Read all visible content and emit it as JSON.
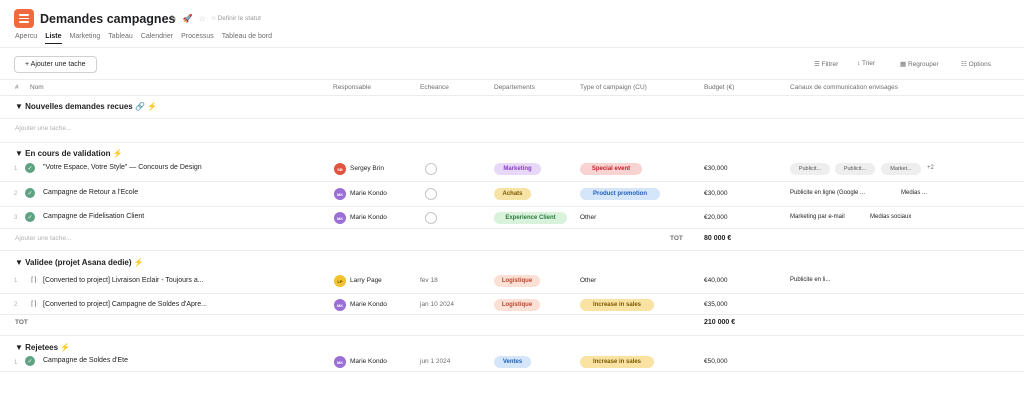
{
  "header": {
    "title": "Demandes campagnes",
    "status": "○ Definir le statut",
    "tabs": [
      "Apercu",
      "Liste",
      "Marketing",
      "Tableau",
      "Calendrier",
      "Processus",
      "Tableau de bord"
    ]
  },
  "toolbar": {
    "add_task": "+ Ajouter une tache",
    "filter": "☰ Filtrer",
    "sort": "↕ Trier",
    "group": "▦ Regrouper",
    "options": "☷ Options"
  },
  "columns": {
    "hash": "#",
    "name": "Nom",
    "owner": "Responsable",
    "due": "Echeance",
    "dept": "Departements",
    "type": "Type of campaign (CU)",
    "budget": "Budget (€)",
    "channels": "Canaux de communication envisages"
  },
  "sections": {
    "s1": {
      "title": "▼ Nouvelles demandes recues 🔗 ⚡",
      "add": "Ajouter une tache..."
    },
    "s2": {
      "title": "▼ En cours de validation ⚡",
      "add": "Ajouter une tache...",
      "tot_label": "TOT",
      "tot_value": "80 000 €",
      "rows": [
        {
          "num": "1",
          "name": "\"Votre Espace, Votre Style\" — Concours de Design",
          "avatar": "SB",
          "owner": "Sergey Brin",
          "dept": "Marketing",
          "type": "Special event",
          "budget": "€30,000",
          "chips": [
            "Publicit...",
            "Publicit...",
            "Market..."
          ],
          "more": "+2"
        },
        {
          "num": "2",
          "name": "Campagne de Retour a l'Ecole",
          "avatar": "MK",
          "owner": "Marie Kondo",
          "dept": "Achats",
          "type": "Product promotion",
          "budget": "€30,000",
          "chan1": "Publicite en ligne (Google ...",
          "chan2": "Medias ..."
        },
        {
          "num": "3",
          "name": "Campagne de Fidelisation Client",
          "avatar": "MK",
          "owner": "Marie Kondo",
          "dept": "Experience Client",
          "type": "Other",
          "budget": "€20,000",
          "chan1": "Marketing par e-mail",
          "chan2": "Medias sociaux"
        }
      ]
    },
    "s3": {
      "title": "▼ Validee (projet Asana dedie) ⚡",
      "tot_label": "TOT",
      "tot_value": "210 000 €",
      "rows": [
        {
          "num": "1",
          "name": "[Converted to project] Livraison Eclair - Toujours a...",
          "avatar": "LP",
          "owner": "Larry Page",
          "due": "fev 18",
          "dept": "Logistique",
          "type": "Other",
          "budget": "€40,000",
          "chan1": "Publicite en li..."
        },
        {
          "num": "2",
          "name": "[Converted to project] Campagne de Soldes d'Apre...",
          "avatar": "MK",
          "owner": "Marie Kondo",
          "due": "jan 10 2024",
          "dept": "Logistique",
          "type": "Increase in sales",
          "budget": "€35,000"
        }
      ]
    },
    "s4": {
      "title": "▼ Rejetees ⚡",
      "rows": [
        {
          "num": "1",
          "name": "Campagne de Soldes d'Ete",
          "avatar": "MK",
          "owner": "Marie Kondo",
          "due": "jun 1 2024",
          "dept": "Ventes",
          "type": "Increase in sales",
          "budget": "€50,000"
        }
      ]
    }
  },
  "colors": {
    "accent": "#f06a3d",
    "check": "#5da283",
    "marketing_bg": "#e8d8f7",
    "marketing_fg": "#8a3fc7",
    "special_bg": "#f9d2d2",
    "special_fg": "#c2202a",
    "achats_bg": "#f8e3a6",
    "achats_fg": "#7a5a00",
    "product_bg": "#d5e6fb",
    "product_fg": "#1f5fb8",
    "experience_bg": "#d8f2dc",
    "experience_fg": "#2b7a3b",
    "logistique_bg": "#fbe0d5",
    "logistique_fg": "#b9472b",
    "sales_bg": "#f9e2a2",
    "sales_fg": "#7a5a00",
    "ventes_bg": "#d5e6fb",
    "ventes_fg": "#1f5fb8"
  }
}
